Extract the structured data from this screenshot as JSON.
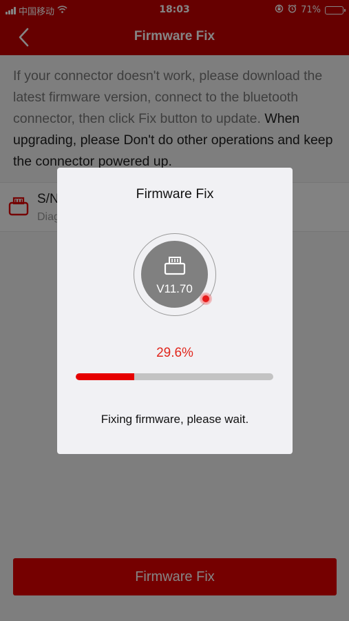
{
  "status_bar": {
    "carrier": "中国移动",
    "time": "18:03",
    "battery": "71%",
    "battery_level": 0.71,
    "icons": [
      "signal-icon",
      "wifi-icon",
      "orientation-lock-icon",
      "alarm-icon",
      "battery-icon"
    ]
  },
  "nav": {
    "title": "Firmware Fix",
    "back_icon": "chevron-left-icon"
  },
  "instructions": {
    "normal": "If your connector doesn't work, please download the latest firmware version, connect to the bluetooth connector, then click Fix button to update. ",
    "emphasis": "When upgrading, please Don't do other operations and keep the connector powered up."
  },
  "device": {
    "sn_label": "S/N",
    "sub_label": "Diag",
    "icon": "connector-icon"
  },
  "bottom_button": {
    "label": "Firmware Fix"
  },
  "modal": {
    "title": "Firmware Fix",
    "version": "V11.70",
    "percent_text": "29.6%",
    "progress": 0.296,
    "message": "Fixing firmware, please wait.",
    "icon": "connector-icon"
  },
  "colors": {
    "brand_red": "#c40000",
    "accent_red": "#e60000",
    "percent_red": "#e1261c"
  }
}
